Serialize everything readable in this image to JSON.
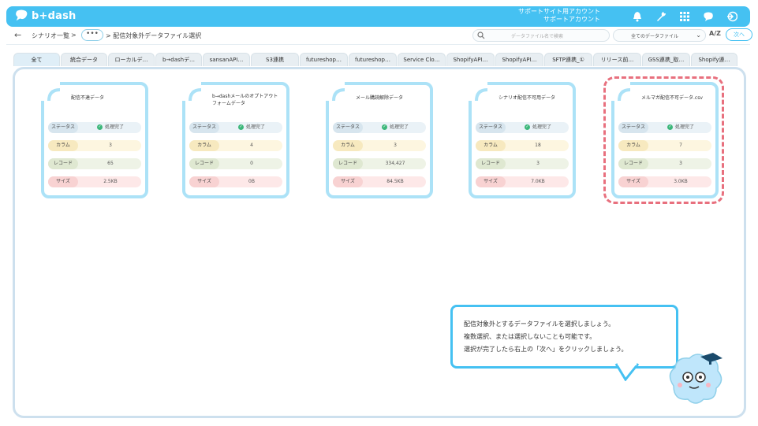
{
  "header": {
    "logo_text": "b+dash",
    "account_line1": "サポートサイト用アカウント",
    "account_line2": "サポートアカウント",
    "icons": [
      "bell-icon",
      "wrench-icon",
      "grid-icon",
      "chat-icon",
      "logout-icon"
    ]
  },
  "subbar": {
    "crumb_root": "シナリオ一覧",
    "crumb_sep1": ">",
    "crumb_more": "•••",
    "crumb_current": "> 配信対象外データファイル選択",
    "search_placeholder": "データファイル名で検索",
    "select_value": "全てのデータファイル",
    "sort_label": "A/Z",
    "next_label": "次へ"
  },
  "tabs": [
    {
      "label": "全て",
      "active": true
    },
    {
      "label": "統合データ"
    },
    {
      "label": "ローカルデ…"
    },
    {
      "label": "b→dashデ…"
    },
    {
      "label": "sansanAPI…"
    },
    {
      "label": "S3連携"
    },
    {
      "label": "futureshop…"
    },
    {
      "label": "futureshop…"
    },
    {
      "label": "Service Clo…"
    },
    {
      "label": "ShopifyAPI…"
    },
    {
      "label": "ShopifyAPI…"
    },
    {
      "label": "SFTP連携_①"
    },
    {
      "label": "リリース前…"
    },
    {
      "label": "GSS連携_取…"
    },
    {
      "label": "Shopify連…"
    }
  ],
  "labels": {
    "status": "ステータス",
    "column": "カラム",
    "record": "レコード",
    "size": "サイズ"
  },
  "cards": [
    {
      "title": "配信不達データ",
      "status": "処理完了",
      "columns": "3",
      "records": "65",
      "size": "2.5KB"
    },
    {
      "title": "b→dashメールのオプトアウトフォームデータ",
      "status": "処理完了",
      "columns": "4",
      "records": "0",
      "size": "0B"
    },
    {
      "title": "メール購読解除データ",
      "status": "処理完了",
      "columns": "3",
      "records": "334,427",
      "size": "84.5KB"
    },
    {
      "title": "シナリオ配信不可用データ",
      "status": "処理完了",
      "columns": "18",
      "records": "3",
      "size": "7.0KB"
    },
    {
      "title": "メルマガ配信不可データ.csv",
      "status": "処理完了",
      "columns": "7",
      "records": "3",
      "size": "3.0KB"
    }
  ],
  "bubble": {
    "line1": "配信対象外とするデータファイルを選択しましょう。",
    "line2": "複数選択、または選択しないことも可能です。",
    "line3": "選択が完了したら右上の「次へ」をクリックしましょう。"
  },
  "colors": {
    "brand": "#45c1f2",
    "highlight": "#e8707e",
    "card_border": "#ace2f7"
  }
}
